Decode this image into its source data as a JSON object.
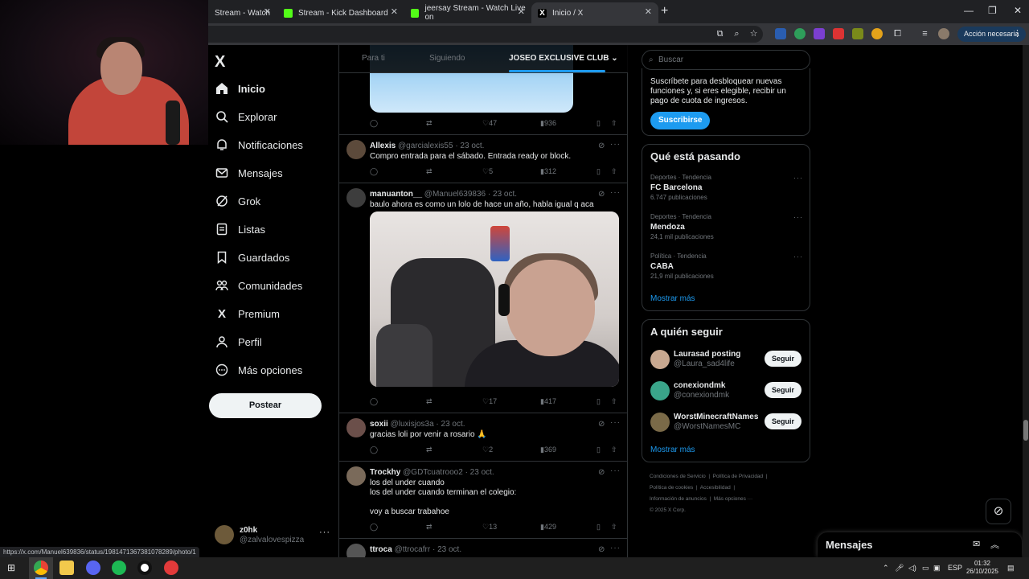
{
  "browser": {
    "tabs": [
      {
        "title": "Stream - Watch"
      },
      {
        "title": "Stream - Kick Dashboard"
      },
      {
        "title": "jeersay Stream - Watch Live on"
      },
      {
        "title": "Inicio / X"
      }
    ],
    "action_button": "Acción necesaria",
    "status_url": "https://x.com/Manuel639836/status/1981471367381078289/photo/1"
  },
  "sidebar": {
    "logo": "X",
    "items": [
      {
        "label": "Inicio",
        "icon": "home-icon"
      },
      {
        "label": "Explorar",
        "icon": "search-icon"
      },
      {
        "label": "Notificaciones",
        "icon": "bell-icon"
      },
      {
        "label": "Mensajes",
        "icon": "mail-icon"
      },
      {
        "label": "Grok",
        "icon": "grok-icon"
      },
      {
        "label": "Listas",
        "icon": "list-icon"
      },
      {
        "label": "Guardados",
        "icon": "bookmark-icon"
      },
      {
        "label": "Comunidades",
        "icon": "communities-icon"
      },
      {
        "label": "Premium",
        "icon": "x-icon"
      },
      {
        "label": "Perfil",
        "icon": "user-icon"
      },
      {
        "label": "Más opciones",
        "icon": "more-circle-icon"
      }
    ],
    "post_button": "Postear",
    "account": {
      "name": "z0hk",
      "handle": "@zalvalovespizza"
    }
  },
  "timeline": {
    "tabs": [
      "Para ti",
      "Siguiendo",
      "JOSEO EXCLUSIVE CLUB"
    ],
    "first_actions": {
      "likes": "47",
      "views": "936"
    },
    "tweets": [
      {
        "name": "Allexis",
        "handle": "@garcialexis55",
        "date": "· 23 oct.",
        "text": "Compro entrada para el sábado. Entrada ready or block.",
        "likes": "5",
        "views": "312",
        "avatar": "#5c4a3b"
      },
      {
        "name": "manuanton__",
        "handle": "@Manuel639836",
        "date": "· 23 oct.",
        "text": "baulo ahora es como un lolo de hace un año, habla igual q aca",
        "likes": "17",
        "views": "417",
        "avatar": "#3d3d3d"
      },
      {
        "name": "soxii",
        "handle": "@luxisjos3a",
        "date": "· 23 oct.",
        "text": "gracias loli por venir a rosario 🙏",
        "likes": "2",
        "views": "369",
        "avatar": "#6b4f4a"
      },
      {
        "name": "Trockhy",
        "handle": "@GDTcuatrooo2",
        "date": "· 23 oct.",
        "text": "los del under cuando\nlos del under cuando terminan el colegio:\n\nvoy a buscar trabahoe",
        "likes": "13",
        "views": "429",
        "avatar": "#7a6a5a"
      },
      {
        "name": "ttroca",
        "handle": "@ttrocafrr",
        "date": "· 23 oct.",
        "text": "",
        "likes": "",
        "views": "",
        "avatar": "#555555"
      }
    ]
  },
  "right": {
    "search_placeholder": "Buscar",
    "premium_text": "Suscríbete para desbloquear nuevas funciones y, si eres elegible, recibir un pago de cuota de ingresos.",
    "subscribe_button": "Suscribirse",
    "trending_title": "Qué está pasando",
    "trends": [
      {
        "category": "Deportes · Tendencia",
        "name": "FC Barcelona",
        "count": "6.747 publicaciones"
      },
      {
        "category": "Deportes · Tendencia",
        "name": "Mendoza",
        "count": "24,1 mil publicaciones"
      },
      {
        "category": "Política · Tendencia",
        "name": "CABA",
        "count": "21,9 mil publicaciones"
      }
    ],
    "show_more": "Mostrar más",
    "who_to_follow_title": "A quién seguir",
    "follow": [
      {
        "name": "Laurasad posting",
        "handle": "@Laura_sad4life",
        "button": "Seguir",
        "avatar": "#c8a890"
      },
      {
        "name": "conexiondmk",
        "handle": "@conexiondmk",
        "button": "Seguir",
        "avatar": "#3aa58a"
      },
      {
        "name": "WorstMinecraftNames",
        "handle": "@WorstNamesMC",
        "button": "Seguir",
        "avatar": "#7a6a48"
      }
    ],
    "footer": [
      "Condiciones de Servicio",
      "Política de Privacidad",
      "Política de cookies",
      "Accesibilidad",
      "Información de anuncios",
      "Más opciones ···",
      "© 2025 X Corp."
    ],
    "messages_title": "Mensajes"
  },
  "taskbar": {
    "lang": "ESP",
    "time": "01:32",
    "date": "26/10/2025"
  }
}
